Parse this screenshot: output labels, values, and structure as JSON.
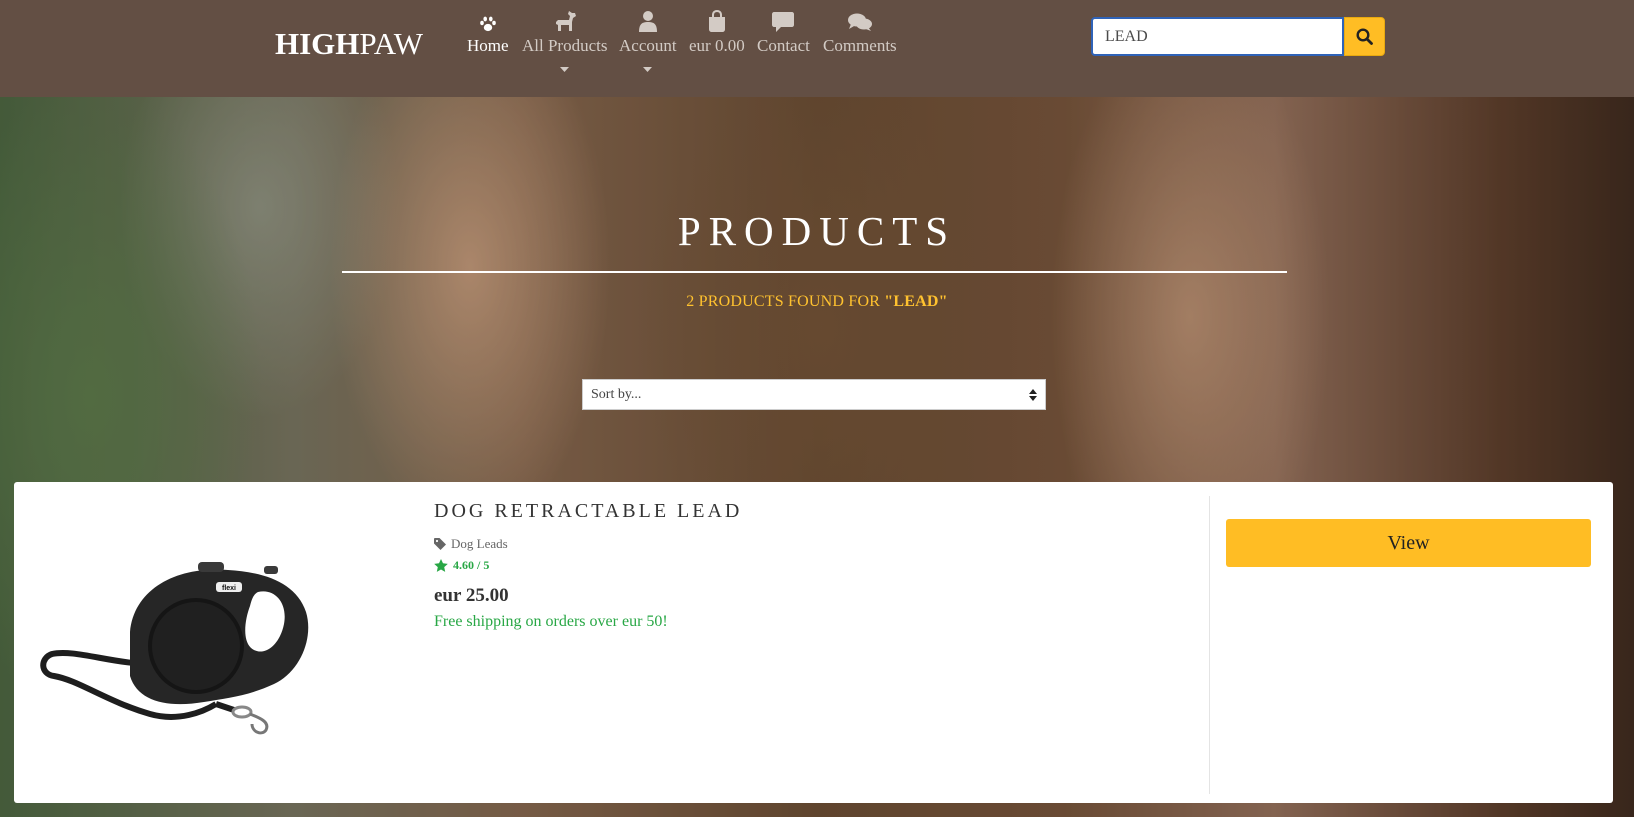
{
  "brand": {
    "bold": "HIGH",
    "light": "PAW"
  },
  "nav": {
    "home": "Home",
    "all_products": "All Products",
    "account": "Account",
    "bag": "eur 0.00",
    "contact": "Contact",
    "comments": "Comments"
  },
  "icons": {
    "home": "paw-icon",
    "all_products": "dog-icon",
    "account": "user-icon",
    "bag": "shopping-bag-icon",
    "contact": "speech-bubble-icon",
    "comments": "comments-icon",
    "search": "search-icon",
    "category": "tag-icon",
    "rating": "star-icon"
  },
  "search": {
    "value": "LEAD"
  },
  "hero": {
    "title": "PRODUCTS",
    "results_prefix": "2 PRODUCTS FOUND FOR ",
    "results_term": "\"LEAD\""
  },
  "sort": {
    "selected": "Sort by..."
  },
  "product": {
    "name": "DOG RETRACTABLE LEAD",
    "category": "Dog Leads",
    "rating": "4.60 / 5",
    "price": "eur 25.00",
    "shipping": "Free shipping on orders over eur 50!",
    "view_label": "View",
    "image_label": "flexi"
  },
  "colors": {
    "navbar": "#634f44",
    "accent": "#ffbd24",
    "rating_green": "#28a745",
    "result_text": "#ffc22f"
  }
}
